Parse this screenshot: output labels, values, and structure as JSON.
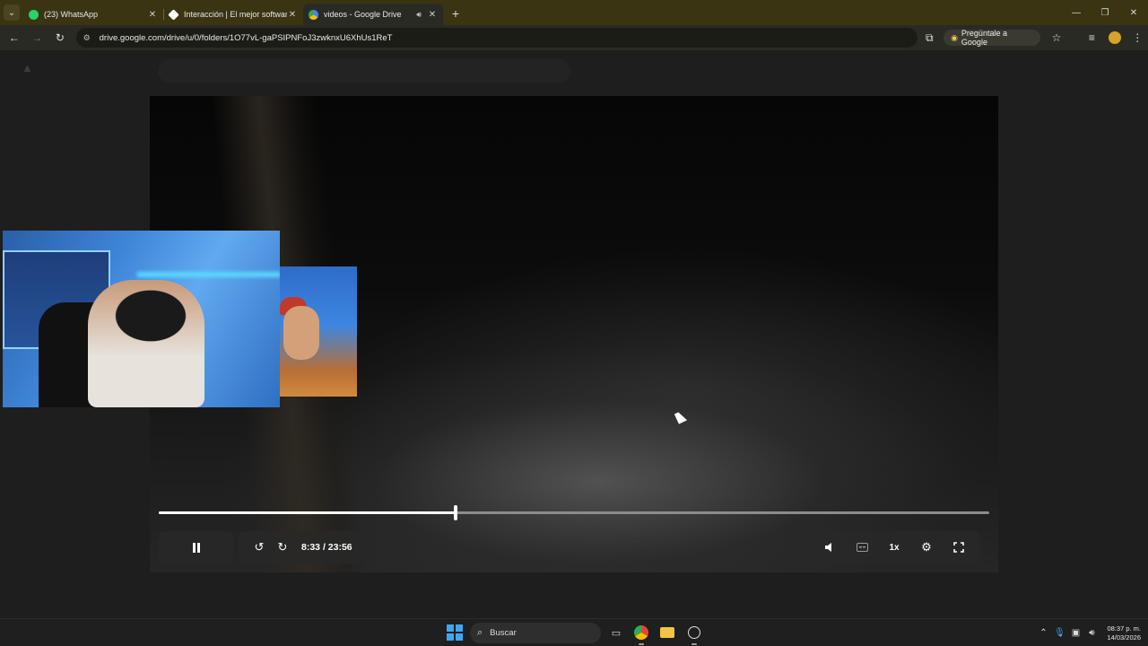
{
  "browser": {
    "tabs": [
      {
        "label": "(23) WhatsApp",
        "icon": "whatsapp-icon",
        "color": "#25D366"
      },
      {
        "label": "Interacción | El mejor software",
        "icon": "diamond-icon",
        "color": "#ffffff"
      },
      {
        "label": "videos - Google Drive",
        "icon": "google-drive-icon",
        "color": "#4285F4",
        "active": true,
        "audio": true
      }
    ],
    "url": "drive.google.com/drive/u/0/folders/1O77vL-gaPSIPNFoJ3zwknxU6XhUs1ReT",
    "ask_google_label": "Pregúntale a Google"
  },
  "player": {
    "current_time": "8:33",
    "separator": "/",
    "duration": "23:56",
    "progress_fraction": 0.3575,
    "speed_label": "1x"
  },
  "taskbar": {
    "search_label": "Buscar",
    "time": "08:37 p. m.",
    "date": "14/03/2026"
  },
  "colors": {
    "tabstrip": "#3a3413",
    "toolbar": "#2a2a24",
    "accent_start": "#3fa6f2"
  }
}
